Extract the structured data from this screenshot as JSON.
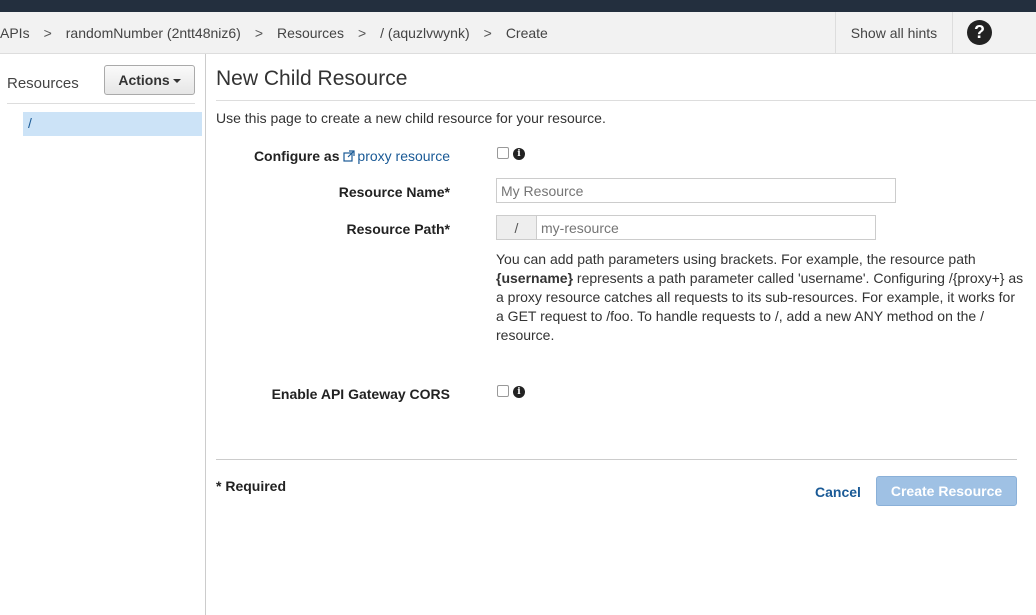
{
  "breadcrumb": {
    "items": [
      "APIs",
      "randomNumber (2ntt48niz6)",
      "Resources",
      "/ (aquzlvwynk)",
      "Create"
    ],
    "separator": ">"
  },
  "header": {
    "hints_label": "Show all hints",
    "help_glyph": "?"
  },
  "sidebar": {
    "title": "Resources",
    "actions_label": "Actions",
    "tree": [
      {
        "label": "/",
        "selected": true
      }
    ]
  },
  "form": {
    "title": "New Child Resource",
    "intro": "Use this page to create a new child resource for your resource.",
    "proxy_label_prefix": "Configure as",
    "proxy_link": "proxy resource",
    "proxy_checked": false,
    "name_label": "Resource Name*",
    "name_placeholder": "My Resource",
    "path_label": "Resource Path*",
    "path_prefix": "/",
    "path_placeholder": "my-resource",
    "help_part1": "You can add path parameters using brackets. For example, the resource path ",
    "help_bold": "{username}",
    "help_part2": " represents a path parameter called 'username'. Configuring /{proxy+} as a proxy resource catches all requests to its sub-resources. For example, it works for a GET request to /foo. To handle requests to /, add a new ANY method on the / resource.",
    "cors_label": "Enable API Gateway CORS",
    "cors_checked": false,
    "required_note": "* Required",
    "cancel_label": "Cancel",
    "create_label": "Create Resource"
  },
  "colors": {
    "topbar": "#232f3e",
    "link": "#1a5a96",
    "selected_bg": "#cce3f7",
    "primary_disabled": "#9fc1e4"
  }
}
